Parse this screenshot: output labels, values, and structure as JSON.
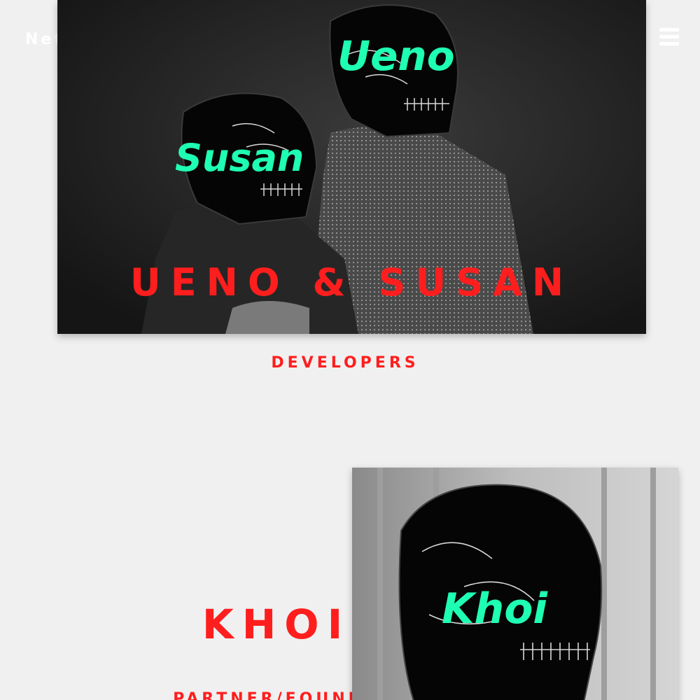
{
  "header": {
    "brand": "Net",
    "menu_icon": "hamburger-menu-icon"
  },
  "team": [
    {
      "name": "UENO & SUSAN",
      "role": "DEVELOPERS",
      "photo_tags": [
        "Ueno",
        "Susan"
      ]
    },
    {
      "name": "KHOI",
      "role": "PARTNER/FOUNDER",
      "photo_tags": [
        "Khoi"
      ]
    }
  ],
  "colors": {
    "background": "#f0f0f0",
    "accent_red": "#ff1e1e",
    "tag_green": "#1fffb4",
    "photo_dark": "#1b1b1b"
  }
}
